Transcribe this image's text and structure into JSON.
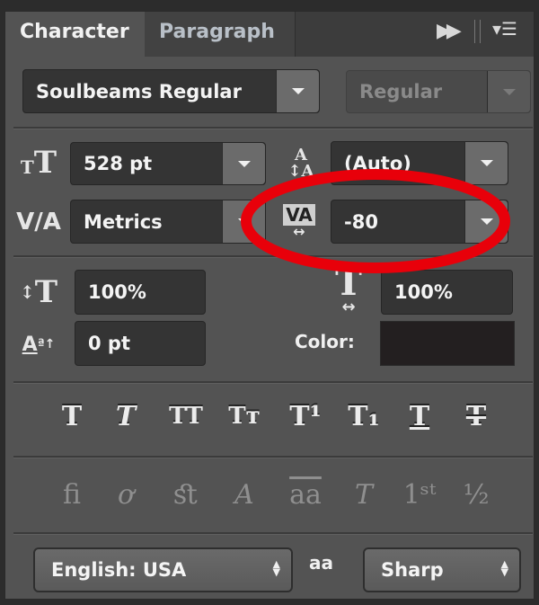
{
  "tabs": [
    {
      "label": "Character",
      "active": true
    },
    {
      "label": "Paragraph",
      "active": false
    }
  ],
  "header_icons": [
    "collapse-double-arrow-icon",
    "panel-menu-icon"
  ],
  "font": {
    "family": "Soulbeams Regular",
    "style": "Regular",
    "style_disabled": true
  },
  "size": {
    "value": "528 pt"
  },
  "leading": {
    "value": "(Auto)"
  },
  "kerning": {
    "value": "Metrics"
  },
  "tracking": {
    "value": "-80",
    "highlighted": true,
    "highlight_color": "#e8000a"
  },
  "vertical_scale": {
    "value": "100%"
  },
  "horizontal_scale": {
    "value": "100%"
  },
  "baseline_shift": {
    "value": "0 pt"
  },
  "color": {
    "label": "Color:",
    "swatch": "#231f20"
  },
  "style_buttons": [
    {
      "glyph": "T",
      "name": "faux-bold"
    },
    {
      "glyph": "T",
      "name": "faux-italic"
    },
    {
      "glyph": "TT",
      "name": "all-caps"
    },
    {
      "glyph": "Tт",
      "name": "small-caps"
    },
    {
      "glyph": "T¹",
      "name": "superscript"
    },
    {
      "glyph": "T₁",
      "name": "subscript"
    },
    {
      "glyph": "T",
      "name": "underline"
    },
    {
      "glyph": "T",
      "name": "strikethrough"
    }
  ],
  "opentype_buttons": [
    {
      "glyph": "ﬁ",
      "name": "standard-ligatures"
    },
    {
      "glyph": "ơ",
      "name": "contextual-alternates"
    },
    {
      "glyph": "ﬆ",
      "name": "discretionary-ligatures"
    },
    {
      "glyph": "A",
      "name": "swash"
    },
    {
      "glyph": "aa",
      "name": "stylistic-alternates"
    },
    {
      "glyph": "T",
      "name": "titling-alternates"
    },
    {
      "glyph": "1ˢᵗ",
      "name": "ordinals"
    },
    {
      "glyph": "½",
      "name": "fractions"
    }
  ],
  "language": {
    "value": "English: USA"
  },
  "antialias": {
    "icon_text": "aa",
    "value": "Sharp"
  }
}
